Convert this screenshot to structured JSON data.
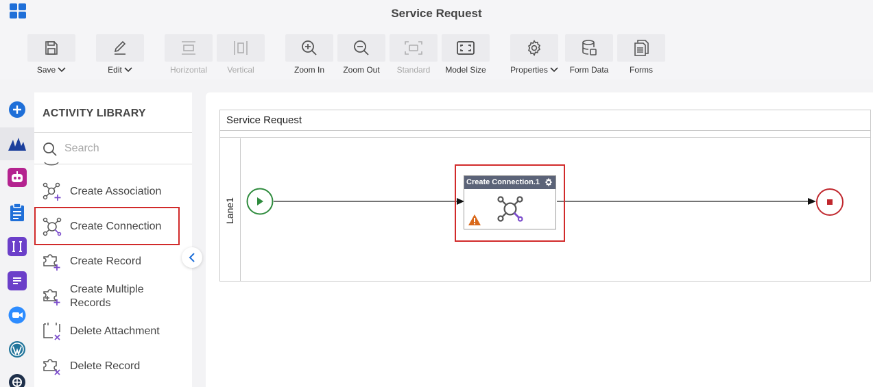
{
  "app": {
    "title": "Service Request"
  },
  "toolbar": {
    "items": [
      {
        "label": "Save",
        "icon": "save-icon",
        "dropdown": true,
        "enabled": true
      },
      {
        "label": "Edit",
        "icon": "edit-icon",
        "dropdown": true,
        "enabled": true
      },
      {
        "label": "Horizontal",
        "icon": "horizontal-icon",
        "enabled": false
      },
      {
        "label": "Vertical",
        "icon": "vertical-icon",
        "enabled": false
      },
      {
        "label": "Zoom In",
        "icon": "zoom-in-icon",
        "enabled": true
      },
      {
        "label": "Zoom Out",
        "icon": "zoom-out-icon",
        "enabled": true
      },
      {
        "label": "Standard",
        "icon": "standard-icon",
        "enabled": false
      },
      {
        "label": "Model Size",
        "icon": "model-size-icon",
        "enabled": true
      },
      {
        "label": "Properties",
        "icon": "gear-icon",
        "dropdown": true,
        "enabled": true
      },
      {
        "label": "Form Data",
        "icon": "database-icon",
        "enabled": true
      },
      {
        "label": "Forms",
        "icon": "forms-icon",
        "enabled": true
      }
    ]
  },
  "rail": {
    "items": [
      {
        "name": "add-icon",
        "color": "#1f6fd8"
      },
      {
        "name": "dynamics-icon",
        "color": "#1c3f9c",
        "active": true
      },
      {
        "name": "bot-icon",
        "color": "#b4238f"
      },
      {
        "name": "clipboard-icon",
        "color": "#1f6fd8"
      },
      {
        "name": "text-icon",
        "color": "#6b3fc9"
      },
      {
        "name": "chat-icon",
        "color": "#6b3fc9"
      },
      {
        "name": "video-icon",
        "color": "#2d8cff"
      },
      {
        "name": "wordpress-icon",
        "color": "#21759b"
      },
      {
        "name": "globe-icon",
        "color": "#1e2f4a"
      }
    ]
  },
  "library": {
    "title": "ACTIVITY LIBRARY",
    "search_placeholder": "Search",
    "items": [
      {
        "label": "Create Association",
        "icon": "create-association-icon"
      },
      {
        "label": "Create Connection",
        "icon": "create-connection-icon",
        "selected": true
      },
      {
        "label": "Create Record",
        "icon": "create-record-icon"
      },
      {
        "label": "Create Multiple Records",
        "label_line1": "Create Multiple",
        "label_line2": "Records",
        "icon": "create-multiple-records-icon"
      },
      {
        "label": "Delete Attachment",
        "icon": "delete-attachment-icon"
      },
      {
        "label": "Delete Record",
        "icon": "delete-record-icon"
      }
    ]
  },
  "canvas": {
    "pool_title": "Service Request",
    "lane_label": "Lane1",
    "activity": {
      "title": "Create Connection.1",
      "has_warning": true
    },
    "colors": {
      "start": "#2e8b3d",
      "end": "#c0272d",
      "highlight": "#d12a2a",
      "activity_header": "#5b6378",
      "connection_icon": "#7c4dcc"
    }
  }
}
